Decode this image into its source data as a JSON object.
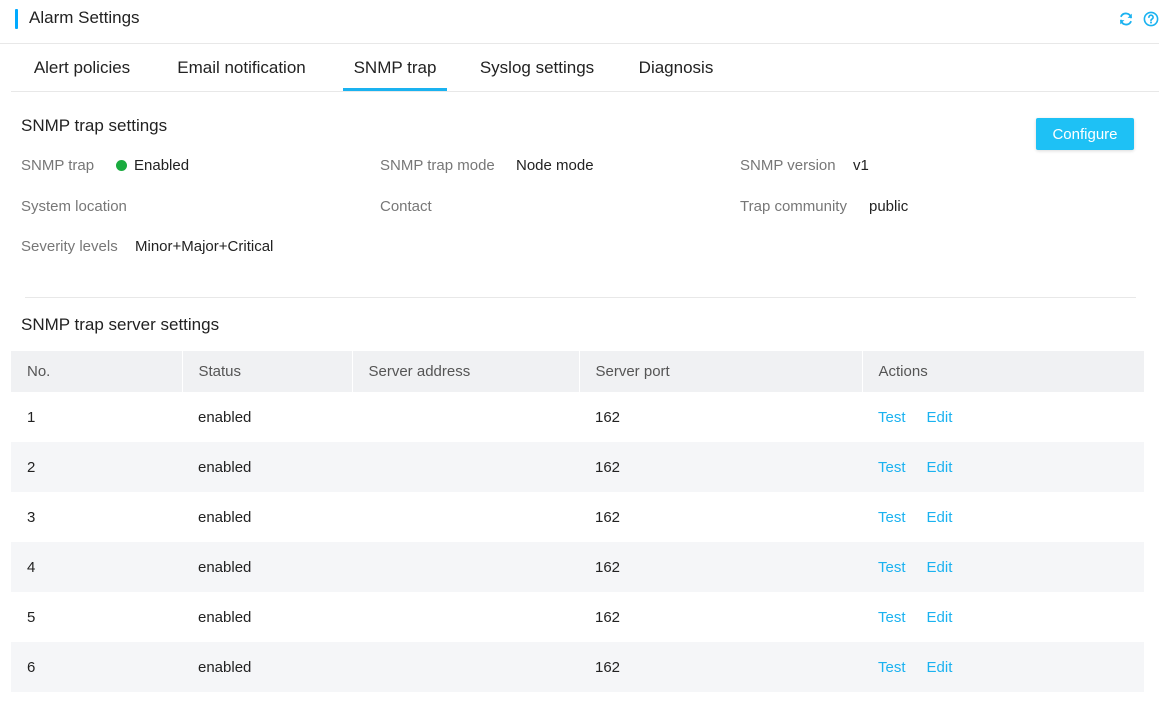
{
  "header": {
    "title": "Alarm Settings",
    "icons": [
      "refresh-icon",
      "help-icon"
    ]
  },
  "tabs": [
    {
      "label": "Alert policies",
      "active": false
    },
    {
      "label": "Email notification",
      "active": false
    },
    {
      "label": "SNMP trap",
      "active": true
    },
    {
      "label": "Syslog settings",
      "active": false
    },
    {
      "label": "Diagnosis",
      "active": false
    }
  ],
  "trap_settings": {
    "title": "SNMP trap settings",
    "configure_label": "Configure",
    "fields": {
      "snmp_trap": {
        "label": "SNMP trap",
        "value": "Enabled",
        "status_color": "#1aab3f"
      },
      "trap_mode": {
        "label": "SNMP trap mode",
        "value": "Node mode"
      },
      "snmp_version": {
        "label": "SNMP version",
        "value": "v1"
      },
      "system_location": {
        "label": "System location",
        "value": ""
      },
      "contact": {
        "label": "Contact",
        "value": ""
      },
      "trap_community": {
        "label": "Trap community",
        "value": "public"
      },
      "severity_levels": {
        "label": "Severity levels",
        "value": "Minor+Major+Critical"
      }
    }
  },
  "server_settings": {
    "title": "SNMP trap server settings",
    "columns": [
      "No.",
      "Status",
      "Server address",
      "Server port",
      "Actions"
    ],
    "rows": [
      {
        "no": "1",
        "status": "enabled",
        "address": "",
        "port": "162"
      },
      {
        "no": "2",
        "status": "enabled",
        "address": "",
        "port": "162"
      },
      {
        "no": "3",
        "status": "enabled",
        "address": "",
        "port": "162"
      },
      {
        "no": "4",
        "status": "enabled",
        "address": "",
        "port": "162"
      },
      {
        "no": "5",
        "status": "enabled",
        "address": "",
        "port": "162"
      },
      {
        "no": "6",
        "status": "enabled",
        "address": "",
        "port": "162"
      }
    ],
    "actions": {
      "test_label": "Test",
      "edit_label": "Edit"
    }
  },
  "colors": {
    "accent": "#1ab2f0",
    "button": "#1ec1f5",
    "enabled": "#1aab3f"
  }
}
